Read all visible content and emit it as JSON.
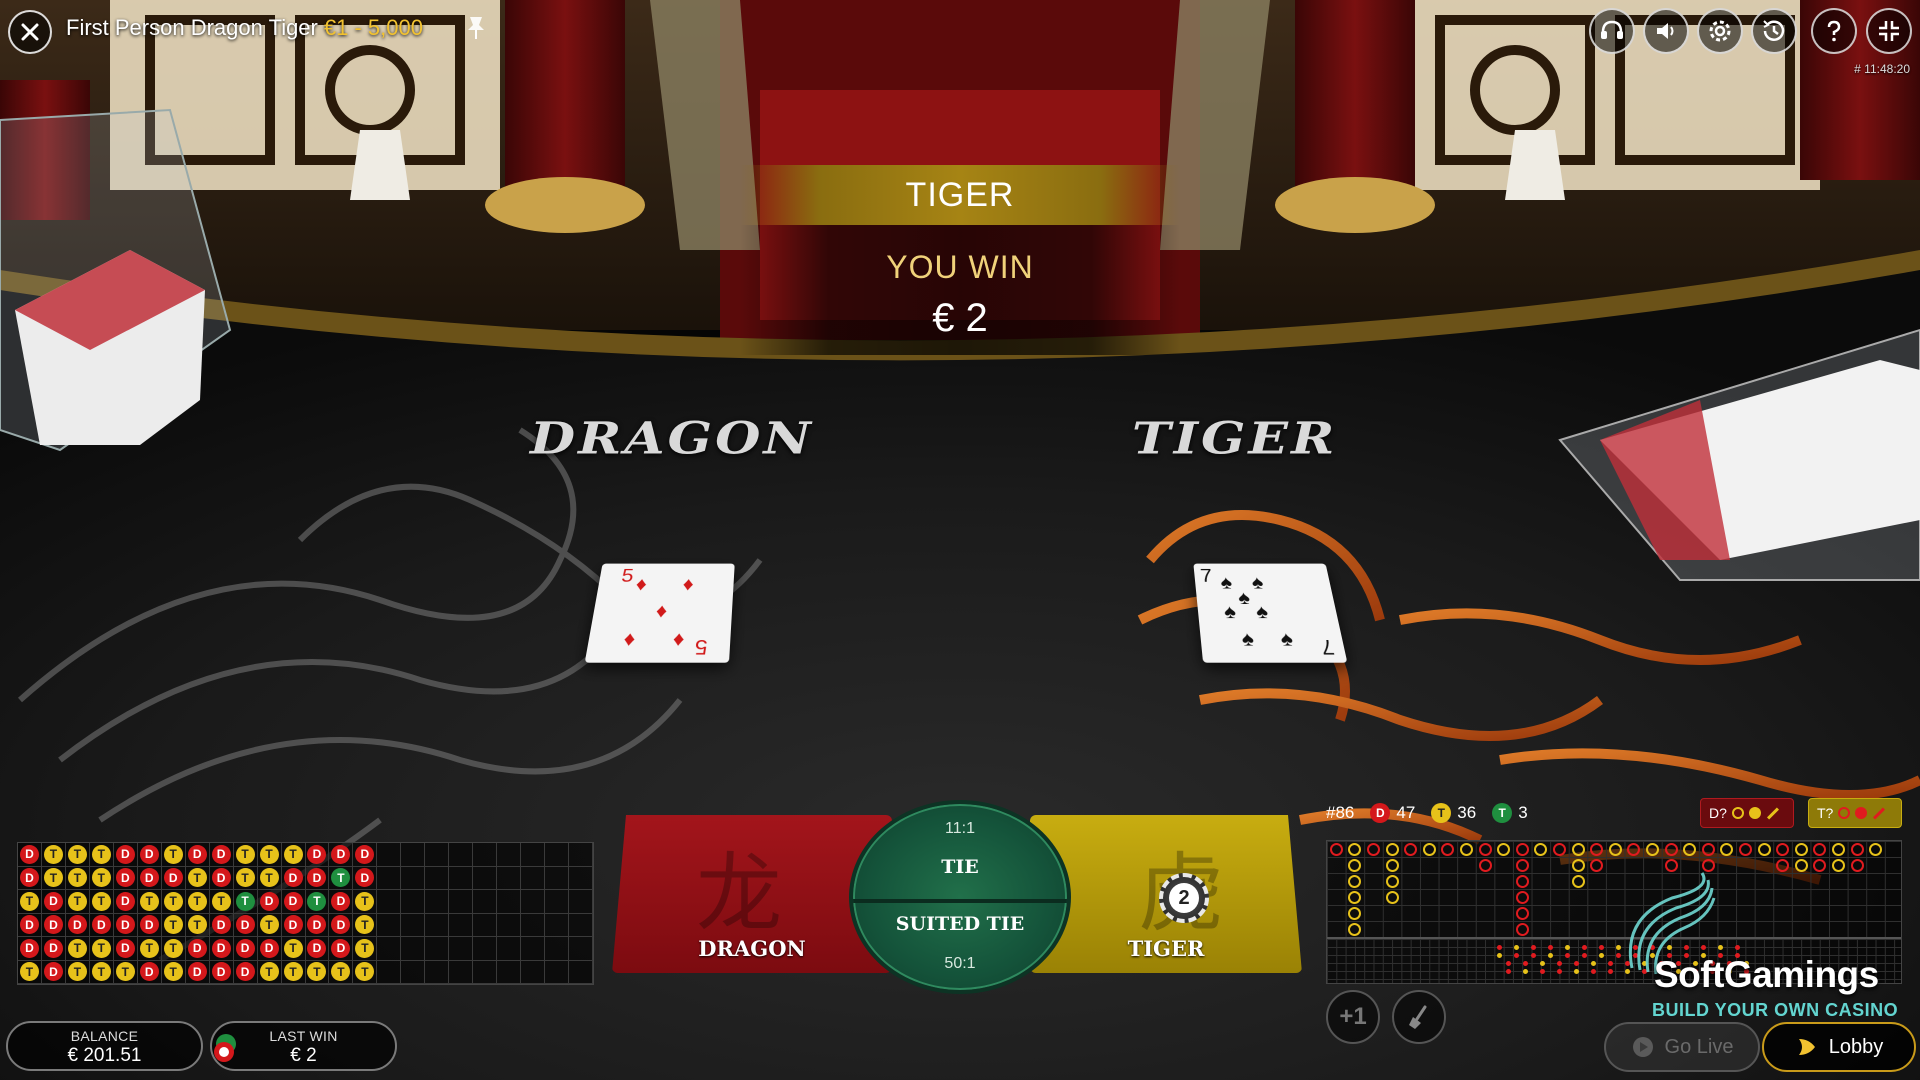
{
  "header": {
    "game_title": "First Person Dragon Tiger",
    "bet_limits": "€1 - 5,000",
    "round_time": "# 11:48:20"
  },
  "controls": {
    "icons": [
      "close-icon",
      "pin-icon",
      "headset-icon",
      "speaker-icon",
      "gear-icon",
      "history-icon",
      "help-icon",
      "fullscreen-icon"
    ]
  },
  "result": {
    "winner": "TIGER",
    "message": "YOU WIN",
    "amount": "€ 2"
  },
  "table": {
    "dragon_label": "DRAGON",
    "tiger_label": "TIGER",
    "dragon_card": {
      "rank": "5",
      "suit": "diamonds"
    },
    "tiger_card": {
      "rank": "7",
      "suit": "spades"
    }
  },
  "bets": {
    "dragon": {
      "glyph": "龙",
      "label": "DRAGON"
    },
    "tiger": {
      "glyph": "虎",
      "label": "TIGER",
      "chip_value": "2"
    },
    "tie": {
      "odds": "11:1",
      "label": "TIE"
    },
    "suited_tie": {
      "odds": "50:1",
      "label": "SUITED TIE"
    }
  },
  "bead_road": [
    [
      "D",
      "D",
      "T",
      "D",
      "D",
      "T"
    ],
    [
      "T",
      "T",
      "D",
      "D",
      "D",
      "D"
    ],
    [
      "T",
      "T",
      "T",
      "D",
      "T",
      "T"
    ],
    [
      "T",
      "T",
      "T",
      "D",
      "T",
      "T"
    ],
    [
      "D",
      "D",
      "D",
      "D",
      "D",
      "T"
    ],
    [
      "D",
      "D",
      "T",
      "D",
      "T",
      "D"
    ],
    [
      "T",
      "D",
      "T",
      "T",
      "T",
      "T"
    ],
    [
      "D",
      "T",
      "T",
      "T",
      "D",
      "D"
    ],
    [
      "D",
      "D",
      "T",
      "D",
      "D",
      "D"
    ],
    [
      "T",
      "T",
      "TIE",
      "D",
      "D",
      "D"
    ],
    [
      "T",
      "T",
      "D",
      "T",
      "D",
      "T"
    ],
    [
      "T",
      "D",
      "D",
      "D",
      "T",
      "T"
    ],
    [
      "D",
      "D",
      "TIE",
      "D",
      "D",
      "T"
    ],
    [
      "D",
      "TIE",
      "D",
      "D",
      "D",
      "T"
    ],
    [
      "D",
      "D",
      "T",
      "T",
      "T",
      "T"
    ]
  ],
  "stats": {
    "round": "#86",
    "dragon_count": "47",
    "tiger_count": "36",
    "tie_count": "3",
    "dragon_badge": "D",
    "tiger_badge": "T",
    "tie_badge": "T",
    "dragon_predict": "D?",
    "tiger_predict": "T?"
  },
  "big_road_columns": [
    [
      "d"
    ],
    [
      "t",
      "t",
      "t",
      "t",
      "t",
      "t"
    ],
    [
      "d"
    ],
    [
      "t",
      "t",
      "t",
      "t"
    ],
    [
      "d"
    ],
    [
      "t"
    ],
    [
      "d"
    ],
    [
      "t"
    ],
    [
      "d",
      "d"
    ],
    [
      "t"
    ],
    [
      "d",
      "d",
      "d",
      "d",
      "d",
      "d"
    ],
    [
      "t"
    ],
    [
      "d"
    ],
    [
      "t",
      "t",
      "t"
    ],
    [
      "d",
      "d"
    ],
    [
      "t"
    ],
    [
      "d"
    ],
    [
      "t"
    ],
    [
      "d",
      "d"
    ],
    [
      "t"
    ],
    [
      "d",
      "d"
    ],
    [
      "t"
    ],
    [
      "d"
    ],
    [
      "t"
    ],
    [
      "d",
      "d"
    ],
    [
      "t",
      "t"
    ],
    [
      "d",
      "d"
    ],
    [
      "t",
      "t"
    ],
    [
      "d",
      "d"
    ],
    [
      "t"
    ]
  ],
  "actions": {
    "repeat_label": "+1",
    "clear_icon": "broom-icon"
  },
  "footer": {
    "balance_label": "BALANCE",
    "balance_value": "€ 201.51",
    "last_win_label": "LAST WIN",
    "last_win_value": "€ 2",
    "go_live_label": "Go Live",
    "lobby_label": "Lobby"
  },
  "brand": {
    "name": "SoftGamings",
    "tagline": "BUILD YOUR OWN CASINO"
  },
  "colors": {
    "dragon": "#a3151b",
    "tiger": "#c8ad10",
    "tie": "#14533a",
    "accent_gold": "#f2c230",
    "brand_teal": "#63d5d0"
  }
}
